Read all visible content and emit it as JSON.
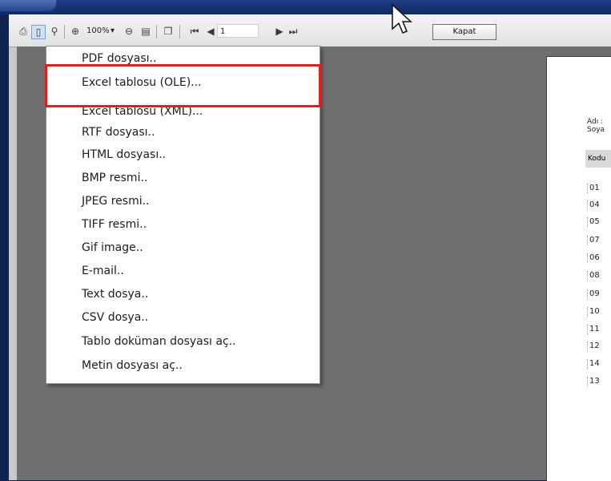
{
  "window": {
    "title": ""
  },
  "toolbar": {
    "icons": [
      "printer-icon",
      "export-icon",
      "find-icon",
      "zoom-in-icon",
      "zoom-out-icon",
      "page-layout-icon",
      "multi-page-icon",
      "first-page-icon",
      "prev-page-icon",
      "next-page-icon",
      "last-page-icon"
    ],
    "zoom": "100%",
    "zoom_arrow": "▾",
    "page": "1",
    "close_label": "Kapat"
  },
  "export_menu": {
    "items": [
      "PDF dosyası..",
      "Excel tablosu (OLE)...",
      "Excel tablosu (XML)...",
      "RTF dosyası..",
      "HTML dosyası..",
      "BMP resmi..",
      "JPEG resmi..",
      "TIFF resmi..",
      "Gif image..",
      "E-mail..",
      "Text dosya..",
      "CSV dosya..",
      "Tablo doküman dosyası aç..",
      "Metin dosyası aç.."
    ],
    "highlighted_index": 1,
    "highlight_color": "#e02020"
  },
  "report_preview": {
    "label1": "Adı :",
    "label2": "Soya",
    "column_header": "Kodu",
    "codes": [
      "01",
      "04",
      "05",
      "07",
      "06",
      "08",
      "09",
      "10",
      "11",
      "12",
      "14",
      "13"
    ]
  },
  "colors": {
    "titlebar": "#0e2a66",
    "preview_bg": "#6f6f6f",
    "toolbar_bg": "#e9e9e9"
  }
}
